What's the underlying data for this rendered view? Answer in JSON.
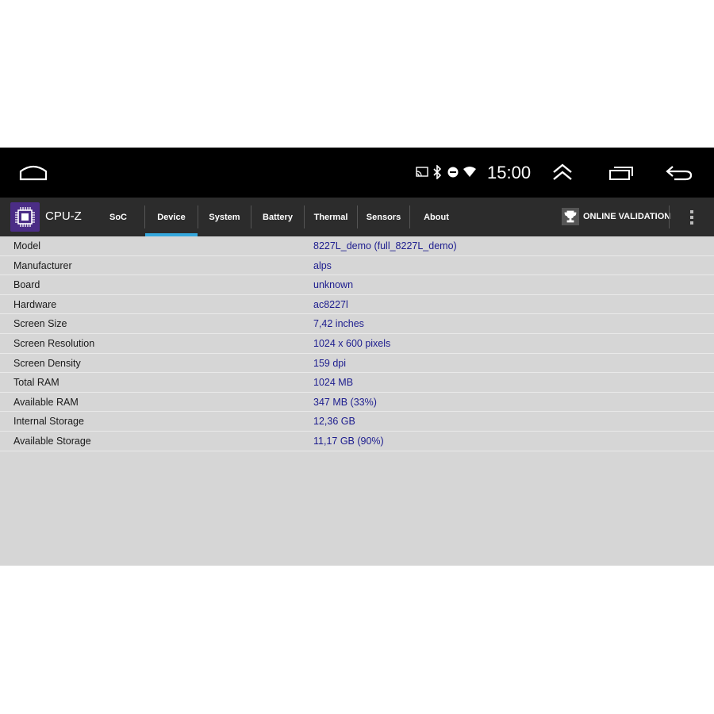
{
  "statusbar": {
    "time": "15:00",
    "icons": [
      "home-icon",
      "cast-icon",
      "bluetooth-icon",
      "do-not-disturb-icon",
      "wifi-icon",
      "chevron-up-icon",
      "recents-icon",
      "back-icon"
    ]
  },
  "app": {
    "title": "CPU-Z",
    "tabs": [
      "SoC",
      "Device",
      "System",
      "Battery",
      "Thermal",
      "Sensors",
      "About"
    ],
    "active_tab": "Device",
    "online_validation_label": "ONLINE VALIDATION",
    "accent_color": "#35a8dd",
    "logo_color": "#4b2d86"
  },
  "device": {
    "rows": [
      {
        "label": "Model",
        "value": "8227L_demo (full_8227L_demo)"
      },
      {
        "label": "Manufacturer",
        "value": "alps"
      },
      {
        "label": "Board",
        "value": "unknown"
      },
      {
        "label": "Hardware",
        "value": "ac8227l"
      },
      {
        "label": "Screen Size",
        "value": "7,42 inches"
      },
      {
        "label": "Screen Resolution",
        "value": "1024 x 600 pixels"
      },
      {
        "label": "Screen Density",
        "value": "159 dpi"
      },
      {
        "label": "Total RAM",
        "value": "1024 MB"
      },
      {
        "label": "Available RAM",
        "value": "347 MB  (33%)"
      },
      {
        "label": "Internal Storage",
        "value": "12,36 GB"
      },
      {
        "label": "Available Storage",
        "value": "11,17 GB (90%)"
      }
    ]
  }
}
